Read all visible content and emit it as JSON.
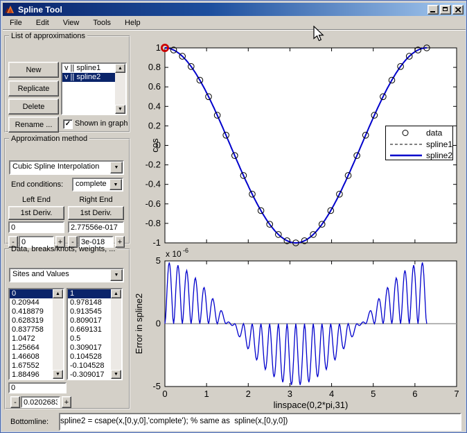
{
  "glyphs": {
    "minus": "-",
    "plus": "+",
    "check": "✓",
    "scroll_up": "▲",
    "scroll_down": "▼",
    "dropdown": "▼"
  },
  "window": {
    "title": "Spline Tool"
  },
  "menu": {
    "items": [
      "File",
      "Edit",
      "View",
      "Tools",
      "Help"
    ]
  },
  "approx_list": {
    "title": "List of approximations",
    "buttons": {
      "new": "New",
      "replicate": "Replicate",
      "delete": "Delete",
      "rename": "Rename ..."
    },
    "items": [
      {
        "label": "v || spline1",
        "selected": false
      },
      {
        "label": "v || spline2",
        "selected": true
      }
    ],
    "shown_checkbox": {
      "label": "Shown in graph",
      "checked": true
    }
  },
  "approx_method": {
    "title": "Approximation method",
    "method": "Cubic Spline Interpolation",
    "end_conditions_label": "End conditions:",
    "end_conditions": "complete",
    "left_end_label": "Left End",
    "right_end_label": "Right End",
    "left_button": "1st Deriv.",
    "right_button": "1st Deriv.",
    "left_value": "0",
    "right_value": "2.77556e-017",
    "left_increment": "0",
    "right_increment": "3e-018"
  },
  "data_panel": {
    "title": "Data, breaks/knots, weights, ...",
    "view": "Sites and Values",
    "sites": [
      "0",
      "0.20944",
      "0.418879",
      "0.628319",
      "0.837758",
      "1.0472",
      "1.25664",
      "1.46608",
      "1.67552",
      "1.88496"
    ],
    "values": [
      "1",
      "0.978148",
      "0.913545",
      "0.809017",
      "0.669131",
      "0.5",
      "0.309017",
      "0.104528",
      "-0.104528",
      "-0.309017"
    ],
    "selected_row": 0,
    "site_edit": "0",
    "increment": "0.0202683"
  },
  "bottomline": {
    "label": "Bottomline:",
    "code": "spline2 = csape(x,[0,y,0],'complete'); % same as  spline(x,[0,y,0])"
  },
  "colors": {
    "spline2": "#0000cc",
    "spline1": "#000000",
    "data_marker": "#000000",
    "highlight": "#cc0000",
    "error_line": "#0000cc",
    "zero_line": "#999999",
    "selection": "#0a246a",
    "titlebar_left": "#0a246a",
    "titlebar_right": "#a6caf0"
  },
  "chart_data": [
    {
      "type": "line",
      "ylabel": "cos",
      "xlim": [
        0,
        7
      ],
      "ylim": [
        -1,
        1
      ],
      "xticks": [
        1,
        2,
        3,
        4,
        5,
        6
      ],
      "yticks": [
        -1,
        -0.8,
        -0.6,
        -0.4,
        -0.2,
        0,
        0.2,
        0.4,
        0.6,
        0.8,
        1
      ],
      "ytick_labels": [
        "-1",
        "-0.8",
        "-0.6",
        "-0.4",
        "-0.2",
        "0",
        "0.2",
        "0.4",
        "0.6",
        "0.8",
        "1"
      ],
      "legend": [
        {
          "label": "data",
          "style": "marker"
        },
        {
          "label": "spline1",
          "style": "dashed"
        },
        {
          "label": "spline2",
          "style": "solid"
        }
      ],
      "legend_position": "right",
      "series": [
        {
          "name": "data",
          "type": "scatter",
          "marker": "circle",
          "x": [
            0,
            0.20944,
            0.41888,
            0.62832,
            0.83776,
            1.0472,
            1.25664,
            1.46608,
            1.67552,
            1.88496,
            2.0944,
            2.30383,
            2.51327,
            2.72271,
            2.93215,
            3.14159,
            3.35103,
            3.56047,
            3.76991,
            3.97935,
            4.18879,
            4.39823,
            4.60767,
            4.81711,
            5.02655,
            5.23599,
            5.44543,
            5.65487,
            5.86431,
            6.07375,
            6.28319
          ],
          "y": [
            1,
            0.978148,
            0.913545,
            0.809017,
            0.669131,
            0.5,
            0.309017,
            0.104528,
            -0.104528,
            -0.309017,
            -0.5,
            -0.669131,
            -0.809017,
            -0.913545,
            -0.978148,
            -1,
            -0.978148,
            -0.913545,
            -0.809017,
            -0.669131,
            -0.5,
            -0.309017,
            -0.104528,
            0.104528,
            0.309017,
            0.5,
            0.669131,
            0.809017,
            0.913545,
            0.978148,
            1
          ]
        },
        {
          "name": "spline1",
          "type": "line",
          "curve": "cos(x)",
          "x_range": [
            0,
            6.28319
          ],
          "style": "dashed"
        },
        {
          "name": "spline2",
          "type": "line",
          "curve": "cos(x)",
          "x_range": [
            0,
            6.28319
          ],
          "style": "solid"
        }
      ],
      "highlighted_point": {
        "x": 0,
        "y": 1
      }
    },
    {
      "type": "line",
      "ylabel": "Error in spline2",
      "xlabel": "linspace(0,2*pi,31)",
      "scale_label": "x 10",
      "scale_exponent": "-6",
      "xlim": [
        0,
        7
      ],
      "ylim_e6": [
        -5,
        5
      ],
      "xticks": [
        0,
        1,
        2,
        3,
        4,
        5,
        6,
        7
      ],
      "xtick_labels": [
        "0",
        "1",
        "2",
        "3",
        "4",
        "5",
        "6",
        "7"
      ],
      "yticks_e6": [
        -5,
        0,
        5
      ],
      "ytick_labels": [
        "-5",
        "0",
        "5"
      ],
      "zero_line": true,
      "error_model": {
        "peak_e6": 4.9,
        "intervals": 30,
        "x_end": 6.28319,
        "shape": "16*t^2*(1-t)^2*cos(x)"
      }
    }
  ]
}
